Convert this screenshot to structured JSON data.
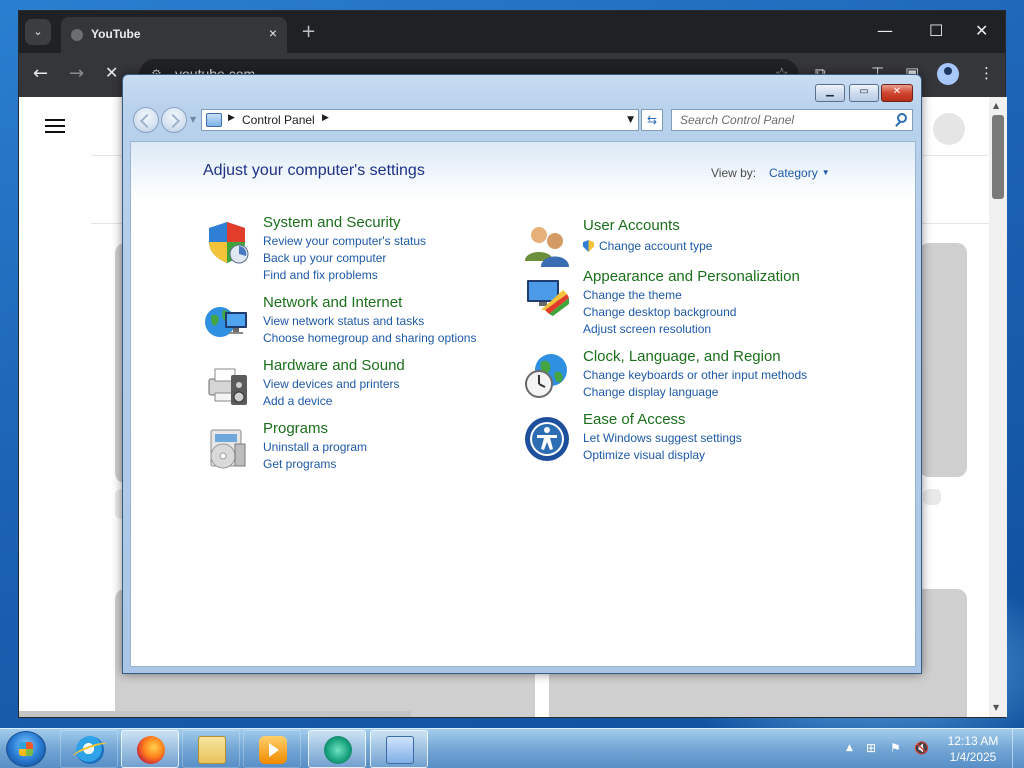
{
  "browser": {
    "tab_title": "YouTube",
    "tab_close": "×",
    "new_tab": "+",
    "window_controls": {
      "minimize": "—",
      "maximize": "☐",
      "close": "✕"
    },
    "url": "youtube.com",
    "nav": {
      "back": "←",
      "forward": "→",
      "stop": "✕"
    }
  },
  "control_panel": {
    "window_controls": {
      "minimize": "▁",
      "maximize": "▭",
      "close": "✕"
    },
    "breadcrumb": {
      "root_label": "Control Panel"
    },
    "search_placeholder": "Search Control Panel",
    "heading": "Adjust your computer's settings",
    "view_by_label": "View by:",
    "view_by_value": "Category",
    "categories_left": [
      {
        "title": "System and Security",
        "icon": "shield-security-icon",
        "links": [
          "Review your computer's status",
          "Back up your computer",
          "Find and fix problems"
        ]
      },
      {
        "title": "Network and Internet",
        "icon": "globe-network-icon",
        "links": [
          "View network status and tasks",
          "Choose homegroup and sharing options"
        ]
      },
      {
        "title": "Hardware and Sound",
        "icon": "printer-speaker-icon",
        "links": [
          "View devices and printers",
          "Add a device"
        ]
      },
      {
        "title": "Programs",
        "icon": "programs-disc-icon",
        "links": [
          "Uninstall a program",
          "Get programs"
        ]
      }
    ],
    "categories_right": [
      {
        "title": "User Accounts",
        "icon": "users-icon",
        "links": [
          "Change account type"
        ]
      },
      {
        "title": "Appearance and Personalization",
        "icon": "appearance-monitor-icon",
        "links": [
          "Change the theme",
          "Change desktop background",
          "Adjust screen resolution"
        ]
      },
      {
        "title": "Clock, Language, and Region",
        "icon": "clock-globe-icon",
        "links": [
          "Change keyboards or other input methods",
          "Change display language"
        ]
      },
      {
        "title": "Ease of Access",
        "icon": "ease-of-access-icon",
        "links": [
          "Let Windows suggest settings",
          "Optimize visual display"
        ]
      }
    ]
  },
  "taskbar": {
    "items": [
      "internet-explorer",
      "firefox",
      "windows-explorer",
      "media-player",
      "app-green",
      "control-panel"
    ],
    "clock": {
      "time": "12:13 AM",
      "date": "1/4/2025"
    }
  }
}
